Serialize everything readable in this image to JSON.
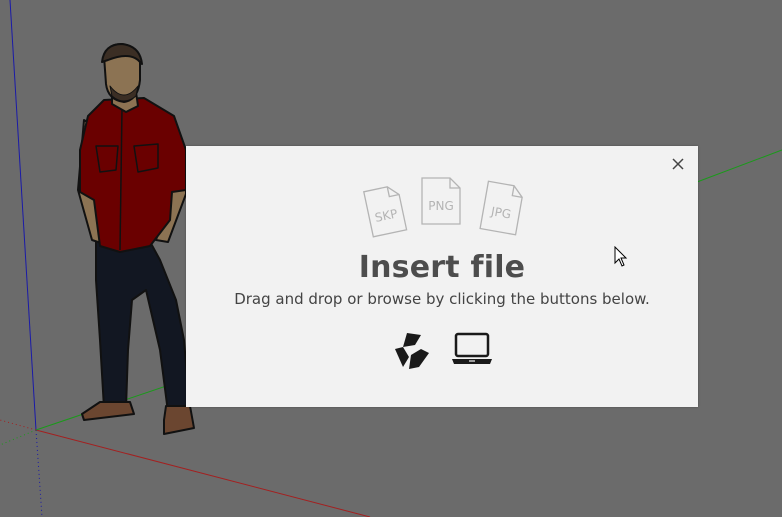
{
  "dialog": {
    "title": "Insert file",
    "subtitle": "Drag and drop or browse by clicking the buttons below.",
    "file_types": [
      "SKP",
      "PNG",
      "JPG"
    ]
  },
  "buttons": {
    "close_icon": "close-icon",
    "cloud_icon": "trimble-connect-icon",
    "local_icon": "laptop-icon"
  },
  "colors": {
    "viewport_bg": "#6b6b6b",
    "dialog_bg": "#f2f2f2",
    "title": "#4d4d4d",
    "axis_red": "#a32020",
    "axis_green": "#1a9a1a",
    "axis_blue": "#1a1aa8",
    "shirt": "#6a0000",
    "pants": "#121722"
  }
}
